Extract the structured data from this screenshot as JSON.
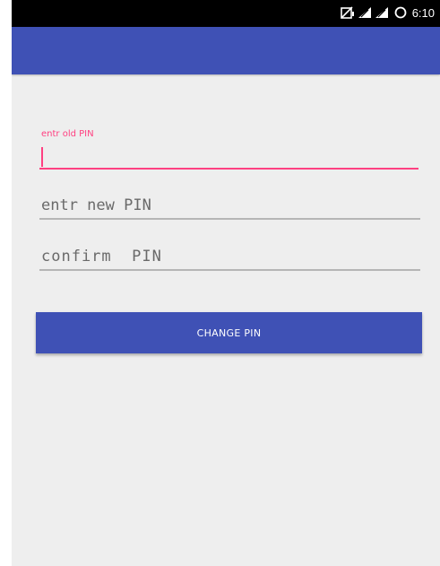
{
  "status_bar": {
    "time": "6:10",
    "icons": [
      "no-sim-icon",
      "signal-icon",
      "signal-icon",
      "battery-ring-icon"
    ]
  },
  "form": {
    "old_pin_label": "entr old PIN",
    "old_pin_value": "",
    "new_pin_placeholder": "entr new PIN",
    "confirm_pin_placeholder": "confirm  PIN",
    "change_button_label": "CHANGE PIN"
  },
  "colors": {
    "primary": "#3f51b5",
    "accent": "#ff4081",
    "background": "#eeeeee",
    "status_bar": "#000000"
  }
}
